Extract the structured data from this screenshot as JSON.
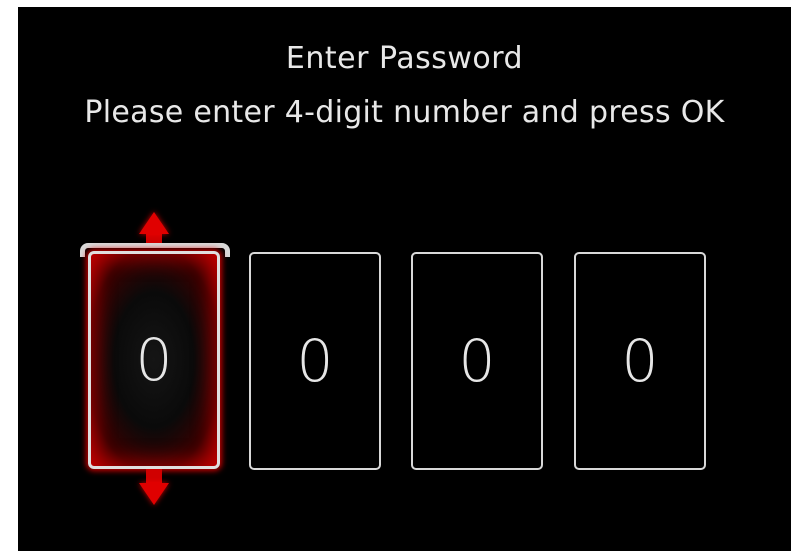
{
  "dialog": {
    "title": "Enter Password",
    "instruction": "Please enter 4-digit number and press OK"
  },
  "pin": {
    "digits": [
      "0",
      "0",
      "0",
      "0"
    ],
    "active_index": 0
  },
  "colors": {
    "background": "#000000",
    "text": "#e8e8e8",
    "box_border": "#d8d8d8",
    "active_highlight": "#e00000"
  },
  "icons": {
    "increment": "arrow-up-icon",
    "decrement": "arrow-down-icon"
  }
}
